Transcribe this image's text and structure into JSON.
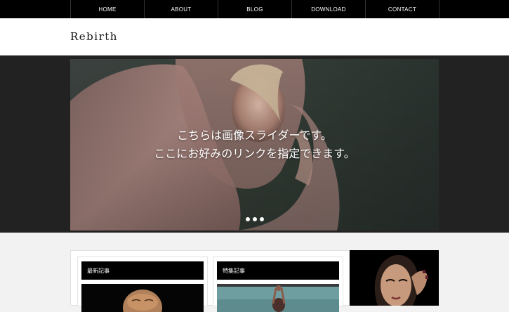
{
  "nav": {
    "items": [
      {
        "label": "HOME"
      },
      {
        "label": "ABOUT"
      },
      {
        "label": "BLOG"
      },
      {
        "label": "DOWNLOAD"
      },
      {
        "label": "CONTACT"
      }
    ]
  },
  "header": {
    "logo": "Rebirth"
  },
  "slider": {
    "caption_line1": "こちらは画像スライダーです。",
    "caption_line2": "ここにお好みのリンクを指定できます。",
    "dot_count": 3
  },
  "sections": {
    "latest": {
      "title": "最新記事"
    },
    "featured": {
      "title": "特集記事"
    }
  },
  "colors": {
    "nav_bg": "#000000",
    "hero_band": "#222222",
    "page_bg": "#f2f2f2"
  }
}
